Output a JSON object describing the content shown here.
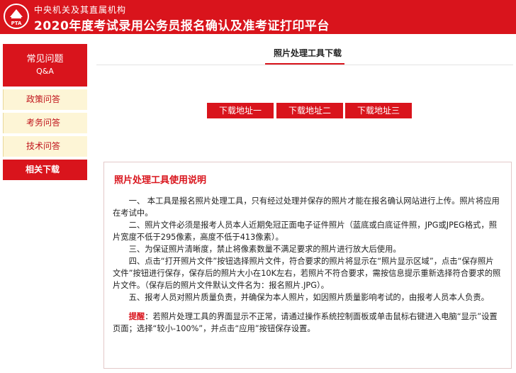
{
  "header": {
    "org": "中央机关及其直属机构",
    "title": "2020年度考试录用公务员报名确认及准考证打印平台",
    "logo_text": "PTA"
  },
  "sidebar": {
    "faq_title": "常见问题",
    "faq_sub": "Q&A",
    "items": [
      {
        "label": "政策问答"
      },
      {
        "label": "考务问答"
      },
      {
        "label": "技术问答"
      },
      {
        "label": "相关下载"
      }
    ]
  },
  "main": {
    "title": "照片处理工具下载",
    "buttons": [
      "下载地址一",
      "下载地址二",
      "下载地址三"
    ]
  },
  "instructions": {
    "title": "照片处理工具使用说明",
    "paragraphs": [
      "一、 本工具是报名照片处理工具，只有经过处理并保存的照片才能在报名确认网站进行上传。照片将应用在考试中。",
      "二、照片文件必须是报考人员本人近期免冠正面电子证件照片（蓝底或白底证件照，JPG或JPEG格式，照片宽度不低于295像素，高度不低于413像素）。",
      "三、为保证照片清晰度，禁止将像素数量不满足要求的照片进行放大后使用。",
      "四、点击“打开照片文件”按钮选择照片文件，符合要求的照片将显示在“照片显示区域”，点击“保存照片文件”按钮进行保存，保存后的照片大小在10K左右，若照片不符合要求，需按信息提示重新选择符合要求的照片文件。（保存后的照片文件默认文件名为：报名照片.JPG）。",
      "五、报考人员对照片质量负责，并确保为本人照片，如因照片质量影响考试的，由报考人员本人负责。"
    ],
    "tip_label": "提醒",
    "tip_text": "：若照片处理工具的界面显示不正常，请通过操作系统控制面板或单击鼠标右键进入电脑“显示”设置页面；选择“较小-100%”，并点击“应用”按钮保存设置。"
  }
}
